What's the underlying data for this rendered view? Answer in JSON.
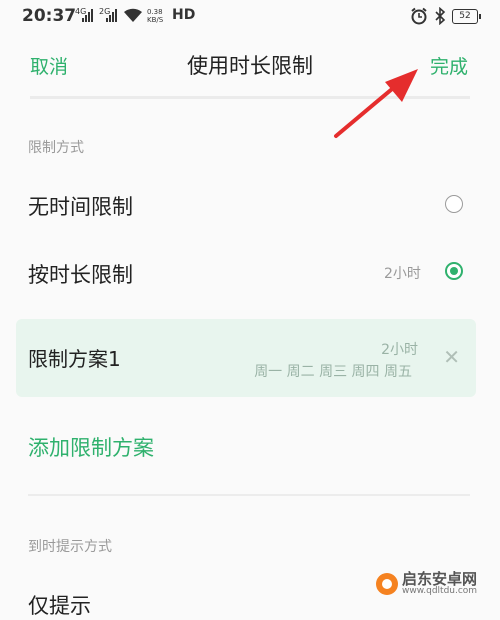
{
  "status_bar": {
    "time": "20:37",
    "signal1_label": "4G",
    "signal2_label": "2G",
    "speed_value": "0.38",
    "speed_unit": "KB/S",
    "network": "HD",
    "battery": "52",
    "icons": [
      "alarm-icon",
      "bluetooth-icon",
      "battery-icon"
    ]
  },
  "header": {
    "cancel_label": "取消",
    "title": "使用时长限制",
    "done_label": "完成"
  },
  "limit_mode": {
    "section_label": "限制方式",
    "options": [
      {
        "label": "无时间限制",
        "value": "",
        "selected": false
      },
      {
        "label": "按时长限制",
        "value": "2小时",
        "selected": true
      }
    ]
  },
  "plans": [
    {
      "name": "限制方案1",
      "duration": "2小时",
      "days": "周一 周二 周三 周四 周五"
    }
  ],
  "add_plan_label": "添加限制方案",
  "reminder": {
    "section_label": "到时提示方式",
    "first_option": "仅提示"
  },
  "watermark": {
    "name": "启东安卓网",
    "url": "www.qdltdu.com"
  },
  "colors": {
    "accent": "#2fb16d",
    "card_bg": "#e8f5ee",
    "arrow": "#e52d2d"
  }
}
